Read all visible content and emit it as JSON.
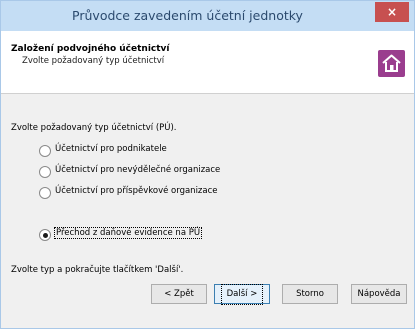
{
  "window": {
    "title": "Průvodce zavedením účetní jednotky",
    "close_label": "×"
  },
  "header": {
    "title": "Založení podvojného účetnictví",
    "subtitle": "Zvolte požadovaný typ účetnictví",
    "icon": "house-icon"
  },
  "prompt": "Zvolte požadovaný typ účetnictví (PÚ).",
  "options": [
    {
      "label": "Účetnictví pro podnikatele",
      "selected": false
    },
    {
      "label": "Účetnictví pro nevýdělečné organizace",
      "selected": false
    },
    {
      "label": "Účetnictví pro příspěvkové organizace",
      "selected": false
    },
    {
      "label": "Přechod z daňové evidence na PÚ",
      "selected": true
    }
  ],
  "hint": "Zvolte typ a pokračujte tlačítkem 'Další'.",
  "buttons": {
    "back": "< Zpět",
    "next": "Další >",
    "cancel": "Storno",
    "help": "Nápověda"
  }
}
